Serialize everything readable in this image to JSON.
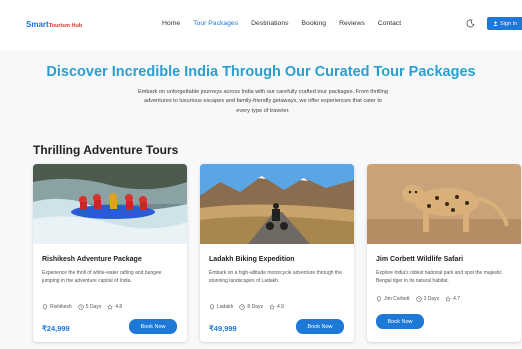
{
  "header": {
    "logo_main": "Smart",
    "logo_sub": "Tourism Hub",
    "nav": [
      "Home",
      "Tour Packages",
      "Destinations",
      "Booking",
      "Reviews",
      "Contact"
    ],
    "active_nav": "Tour Packages",
    "signin_label": "Sign In"
  },
  "hero": {
    "title": "Discover Incredible India Through Our Curated Tour Packages",
    "description": "Embark on unforgettable journeys across India with our carefully crafted tour packages. From thrilling adventures to luxurious escapes and family-friendly getaways, we offer experiences that cater to every type of traveler."
  },
  "section": {
    "title": "Thrilling Adventure Tours"
  },
  "cards": [
    {
      "title": "Rishikesh Adventure Package",
      "description": "Experience the thrill of white-water rafting and bungee jumping in the adventure capital of India.",
      "location": "Rishikesh",
      "duration": "5 Days",
      "rating": "4.8",
      "price": "₹24,999",
      "button": "Book Now"
    },
    {
      "title": "Ladakh Biking Expedition",
      "description": "Embark on a high-altitude motorcycle adventure through the stunning landscapes of Ladakh.",
      "location": "Ladakh",
      "duration": "8 Days",
      "rating": "4.9",
      "price": "₹49,999",
      "button": "Book Now"
    },
    {
      "title": "Jim Corbett Wildlife Safari",
      "description": "Explore India's oldest national park and spot the majestic Bengal tiger in its natural habitat.",
      "location": "Jim Corbett",
      "duration": "3 Days",
      "rating": "4.7",
      "button": "Book Now"
    }
  ],
  "colors": {
    "accent": "#1d78d6",
    "title": "#2a9fd0",
    "logo_red": "#d8332a"
  }
}
